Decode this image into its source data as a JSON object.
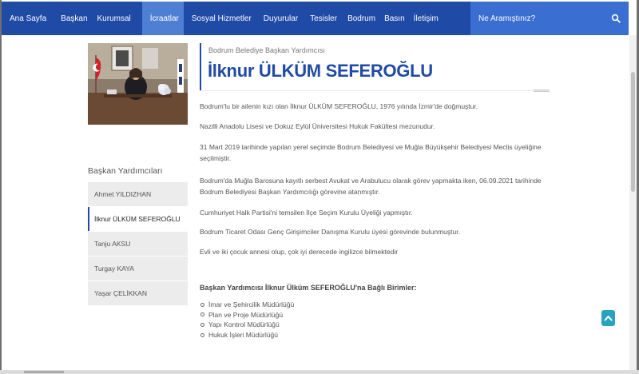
{
  "nav": {
    "items": [
      {
        "label": "Ana Sayfa",
        "active": false
      },
      {
        "label": "Başkan",
        "active": false
      },
      {
        "label": "Kurumsal",
        "active": false
      },
      {
        "label": "İcraatlar",
        "active": true
      },
      {
        "label": "Sosyal Hizmetler",
        "active": false
      },
      {
        "label": "Duyurular",
        "active": false
      },
      {
        "label": "Tesisler",
        "active": false
      },
      {
        "label": "Bodrum",
        "active": false
      },
      {
        "label": "Basın",
        "active": false
      },
      {
        "label": "İletişim",
        "active": false
      }
    ],
    "search_placeholder": "Ne Aramıştınız?",
    "search_icon": "search-icon"
  },
  "sidebar": {
    "title": "Başkan Yardımcıları",
    "items": [
      {
        "label": "Ahmet YILDIZHAN",
        "active": false
      },
      {
        "label": "İlknur ÜLKÜM SEFEROĞLU",
        "active": true
      },
      {
        "label": "Tanju AKSU",
        "active": false
      },
      {
        "label": "Turgay KAYA",
        "active": false
      },
      {
        "label": "Yaşar ÇELİKKAN",
        "active": false
      }
    ]
  },
  "content": {
    "subtitle": "Bodrum Belediye Başkan Yardımcısı",
    "name": "İlknur ÜLKÜM SEFEROĞLU",
    "paragraphs": [
      "Bodrum'lu bir ailenin kızı olan İlknur ÜLKÜM SEFEROĞLU, 1976 yılında İzmir'de doğmuştur.",
      "Nazilli Anadolu Lisesi ve Dokuz Eylül Üniversitesi Hukuk Fakültesi mezunudur.",
      "31 Mart 2019 tarihinde yapılan yerel seçimde Bodrum Belediyesi ve Muğla Büyükşehir Belediyesi Meclis üyeliğine seçilmiştir.",
      "Bodrum'da Muğla Barosuna kayıtlı serbest Avukat ve Arabulucu olarak görev yapmakta iken, 06.09.2021 tarihinde Bodrum Belediyesi Başkan Yardımcılığı görevine atanmıştır.",
      "Cumhuriyet Halk Partisi'ni temsilen İlçe Seçim Kurulu Üyeliği yapmıştır.",
      "Bodrum Ticaret Odası Genç Girişimciler Danışma Kurulu üyesi görevinde bulunmuştur.",
      "Evli ve iki çocuk annesi olup, çok iyi derecede ingilizce bilmektedir"
    ],
    "units_heading": "Başkan Yardımcısı İlknur Ülküm SEFEROĞLU'na Bağlı Birimler:",
    "units": [
      "İmar ve Şehircilik Müdürlüğü",
      "Plan ve Proje Müdürlüğü",
      "Yapı Kontrol Müdürlüğü",
      "Hukuk İşleri Müdürlüğü"
    ]
  },
  "colors": {
    "nav_bg": "#1f4aa6",
    "nav_active": "#4f7fd3",
    "search_bg": "#3a6ed0",
    "accent": "#1f4aa6",
    "scroll_top_btn": "#27a3bf"
  }
}
